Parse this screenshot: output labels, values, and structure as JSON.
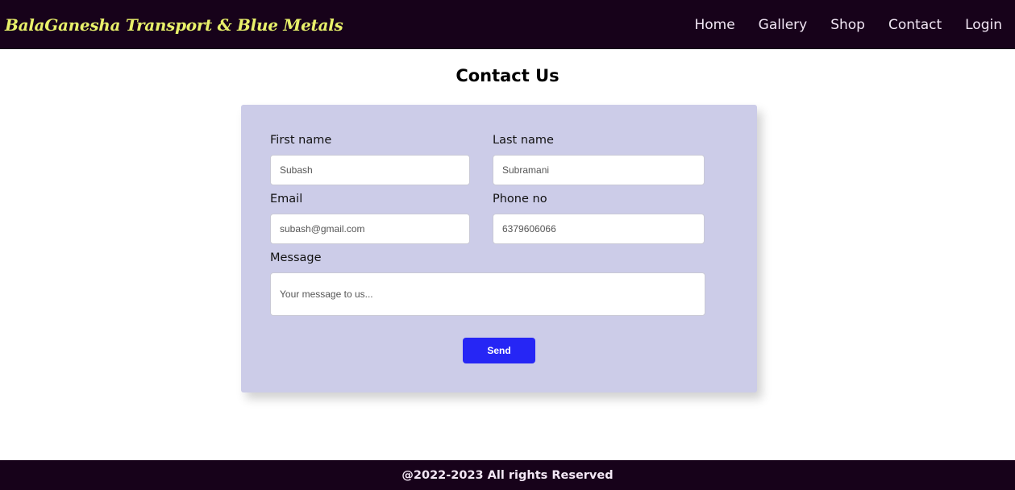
{
  "navbar": {
    "brand": "BalaGanesha Transport & Blue Metals",
    "links": [
      "Home",
      "Gallery",
      "Shop",
      "Contact",
      "Login"
    ]
  },
  "page": {
    "title": "Contact Us"
  },
  "form": {
    "first_name": {
      "label": "First name",
      "placeholder": "Subash"
    },
    "last_name": {
      "label": "Last name",
      "placeholder": "Subramani"
    },
    "email": {
      "label": "Email",
      "placeholder": "subash@gmail.com"
    },
    "phone": {
      "label": "Phone no",
      "placeholder": "6379606066"
    },
    "message": {
      "label": "Message",
      "placeholder": "Your message to us..."
    },
    "send_label": "Send"
  },
  "footer": {
    "text": "@2022-2023 All rights Reserved"
  },
  "colors": {
    "navbar_bg": "#17021a",
    "brand": "#e8f06a",
    "card_bg": "#cccce8",
    "send_button": "#2626f5"
  }
}
